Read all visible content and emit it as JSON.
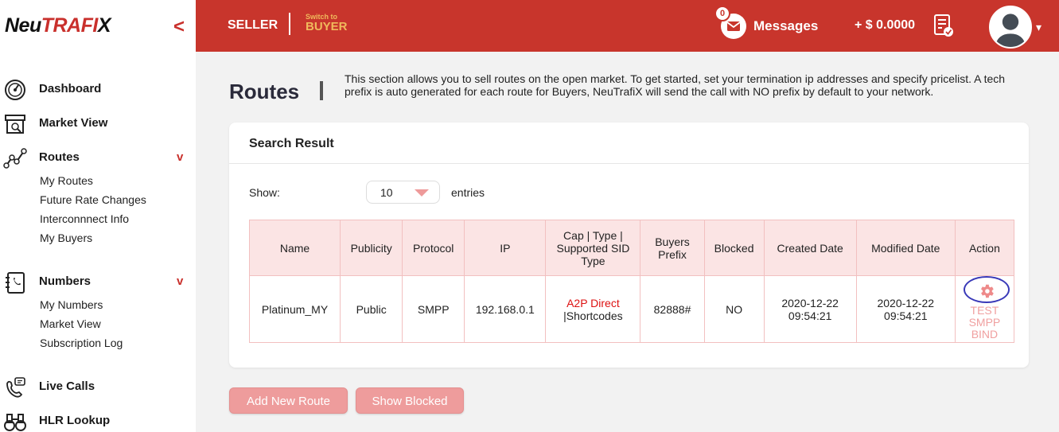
{
  "brand": {
    "logo_prefix": "Neu",
    "logo_accent": "TRAFI",
    "logo_suffix": "X",
    "collapse": "<",
    "accent_color": "#c8352c"
  },
  "sidebar": {
    "items": [
      {
        "label": "Dashboard",
        "icon": "speedometer-icon"
      },
      {
        "label": "Market View",
        "icon": "storefront-icon"
      },
      {
        "label": "Routes",
        "icon": "route-nodes-icon",
        "chevron": "v",
        "children": [
          "My Routes",
          "Future Rate Changes",
          "Interconnnect Info",
          "My Buyers"
        ]
      },
      {
        "label": "Numbers",
        "icon": "phonebook-icon",
        "chevron": "v",
        "children": [
          "My Numbers",
          "Market View",
          "Subscription Log"
        ]
      },
      {
        "label": "Live Calls",
        "icon": "phone-chat-icon"
      },
      {
        "label": "HLR Lookup",
        "icon": "binoculars-icon"
      }
    ]
  },
  "header": {
    "seller": "SELLER",
    "switch_to": "Switch to",
    "buyer": "BUYER",
    "messages_count": "0",
    "messages_label": "Messages",
    "balance": "+ $ 0.0000",
    "avatar_caret": "▾"
  },
  "page": {
    "title": "Routes",
    "description": "This section allows you to sell routes on the open market. To get started, set your termination ip addresses and specify pricelist. A tech prefix is auto generated for each route for Buyers, NeuTrafiX will send the call with NO prefix by default to your network."
  },
  "search": {
    "title": "Search Result",
    "show_label": "Show:",
    "show_value": "10",
    "entries_label": "entries"
  },
  "table": {
    "headers": [
      "Name",
      "Publicity",
      "Protocol",
      "IP",
      "Cap | Type | Supported SID Type",
      "Buyers Prefix",
      "Blocked",
      "Created Date",
      "Modified Date",
      "Action"
    ],
    "rows": [
      {
        "name": "Platinum_MY",
        "publicity": "Public",
        "protocol": "SMPP",
        "ip": "192.168.0.1",
        "service_type": "A2P Direct",
        "sid_type": "|Shortcodes",
        "buyers_prefix": "82888#",
        "blocked": "NO",
        "created_date": "2020-12-22",
        "created_time": "09:54:21",
        "modified_date": "2020-12-22",
        "modified_time": "09:54:21",
        "action_label_1": "TEST",
        "action_label_2": "SMPP",
        "action_label_3": "BIND"
      }
    ]
  },
  "buttons": {
    "add_route": "Add New Route",
    "show_blocked": "Show Blocked"
  }
}
